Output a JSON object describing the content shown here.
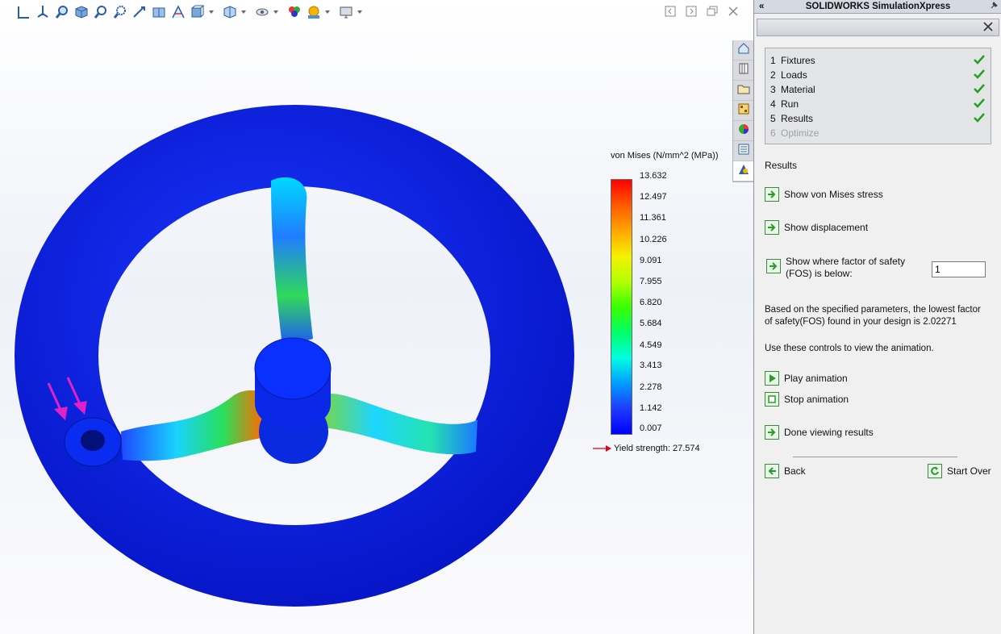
{
  "app": {
    "panel_title": "SOLIDWORKS SimulationXpress"
  },
  "toolbar": {
    "icons": [
      "view-previous-icon",
      "rotate-view-icon",
      "zoom-to-fit-icon",
      "view-3d-icon",
      "zoom-in-icon",
      "zoom-area-icon",
      "pan-icon",
      "section-view-icon",
      "view-settings-icon",
      "view-orientation-icon",
      "display-style-icon",
      "hide-show-icon",
      "edit-appearance-icon",
      "apply-scene-icon",
      "view-settings-monitor-icon"
    ]
  },
  "legend": {
    "title": "von Mises (N/mm^2 (MPa))",
    "ticks": [
      "13.632",
      "12.497",
      "11.361",
      "10.226",
      "9.091",
      "7.955",
      "6.820",
      "5.684",
      "4.549",
      "3.413",
      "2.278",
      "1.142",
      "0.007"
    ],
    "yield_label": "Yield strength: 27.574",
    "colors": {
      "max": "#ff0000",
      "min": "#0000ff",
      "arrow": "#e0001a"
    }
  },
  "steps": [
    {
      "num": "1",
      "label": "Fixtures",
      "done": true
    },
    {
      "num": "2",
      "label": "Loads",
      "done": true
    },
    {
      "num": "3",
      "label": "Material",
      "done": true
    },
    {
      "num": "4",
      "label": "Run",
      "done": true
    },
    {
      "num": "5",
      "label": "Results",
      "done": true
    },
    {
      "num": "6",
      "label": "Optimize",
      "done": false
    }
  ],
  "results": {
    "heading": "Results",
    "show_von_mises": "Show von Mises stress",
    "show_displacement": "Show displacement",
    "show_fos_line1": "Show where factor of safety",
    "show_fos_line2": "(FOS) is below:",
    "fos_value": "1",
    "fos_message_line1": "Based on the specified parameters, the lowest factor",
    "fos_message_line2": "of safety(FOS) found in your design is 2.02271",
    "animation_hint": "Use these controls to view the animation.",
    "play_animation": "Play animation",
    "stop_animation": "Stop animation",
    "done_viewing": "Done viewing results",
    "back": "Back",
    "start_over": "Start Over"
  },
  "colors": {
    "accent_green": "#2e9a2e",
    "check_green": "#22a022",
    "model_blue": "#0a22d8"
  }
}
